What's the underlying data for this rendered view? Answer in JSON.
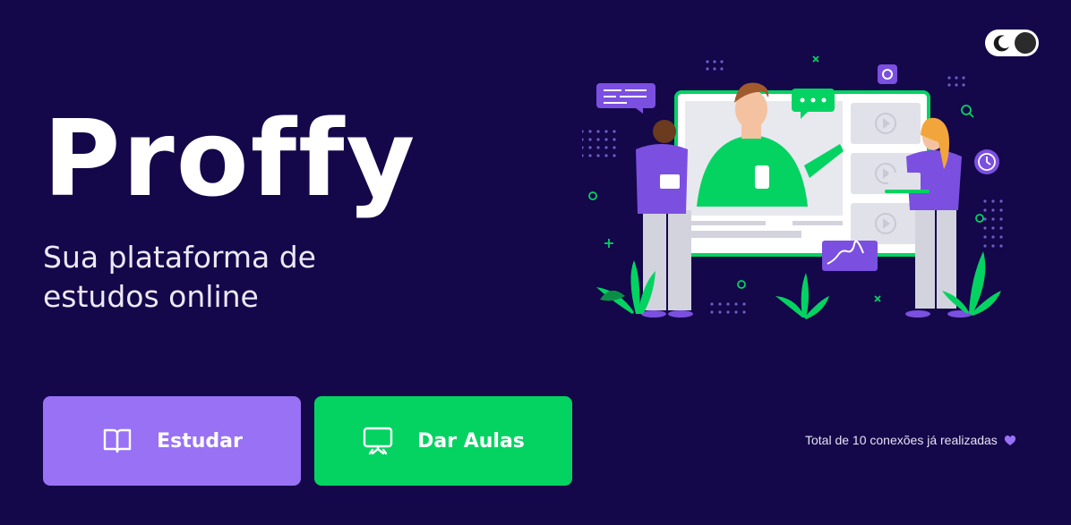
{
  "header": {
    "theme_toggle_label": "",
    "theme_mode": "dark"
  },
  "brand": {
    "logo_text": "Proffy",
    "tagline": "Sua plataforma de estudos online"
  },
  "actions": {
    "study_label": "Estudar",
    "teach_label": "Dar Aulas"
  },
  "footer": {
    "connections_text": "Total de 10 conexões já realizadas",
    "heart_icon": "purple-heart-icon"
  },
  "colors": {
    "background": "#14074a",
    "primary": "#9871f5",
    "secondary": "#04d361",
    "text": "#ffffff"
  }
}
